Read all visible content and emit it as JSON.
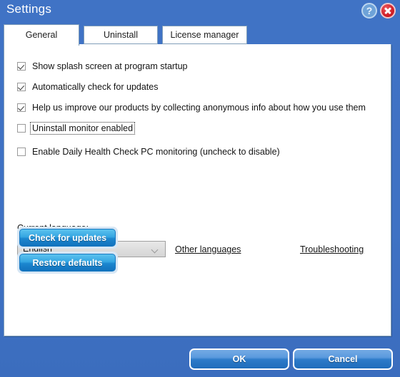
{
  "window": {
    "title": "Settings",
    "help_icon": "question-mark-circle-icon",
    "close_icon": "close-x-icon",
    "accent_blue": "#4073c5",
    "panel_bg": "#ffffff"
  },
  "tabs": [
    {
      "label": "General",
      "active": true
    },
    {
      "label": "Uninstall",
      "active": false
    },
    {
      "label": "License manager",
      "active": false
    }
  ],
  "checkboxes": [
    {
      "label": "Show splash screen at program startup",
      "checked": true,
      "focused": false
    },
    {
      "label": "Automatically check for updates",
      "checked": true,
      "focused": false
    },
    {
      "label": "Help us improve our products by collecting anonymous info about how you use them",
      "checked": true,
      "focused": false
    },
    {
      "label": "Uninstall monitor enabled",
      "checked": false,
      "focused": true
    },
    {
      "label": "Enable Daily Health Check PC monitoring (uncheck to disable)",
      "checked": false,
      "focused": false
    }
  ],
  "language": {
    "label": "Current language:",
    "selected": "English",
    "chevron_icon": "chevron-down-icon",
    "other_languages_link": "Other languages",
    "troubleshooting_link": "Troubleshooting"
  },
  "actions": {
    "check_updates": "Check for updates",
    "restore_defaults": "Restore defaults"
  },
  "footer": {
    "ok": "OK",
    "cancel": "Cancel"
  }
}
